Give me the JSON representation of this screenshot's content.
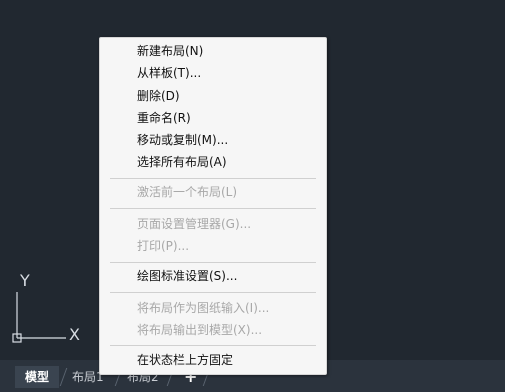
{
  "context_menu": {
    "items": [
      {
        "label": "新建布局(N)",
        "enabled": true
      },
      {
        "label": "从样板(T)...",
        "enabled": true
      },
      {
        "label": "删除(D)",
        "enabled": true
      },
      {
        "label": "重命名(R)",
        "enabled": true
      },
      {
        "label": "移动或复制(M)...",
        "enabled": true
      },
      {
        "label": "选择所有布局(A)",
        "enabled": true
      },
      {
        "label": "激活前一个布局(L)",
        "enabled": false
      },
      {
        "label": "页面设置管理器(G)...",
        "enabled": false
      },
      {
        "label": "打印(P)...",
        "enabled": false
      },
      {
        "label": "绘图标准设置(S)...",
        "enabled": true
      },
      {
        "label": "将布局作为图纸输入(I)...",
        "enabled": false
      },
      {
        "label": "将布局输出到模型(X)...",
        "enabled": false
      },
      {
        "label": "在状态栏上方固定",
        "enabled": true
      }
    ]
  },
  "ucs": {
    "y_label": "Y",
    "x_label": "X"
  },
  "tabs": {
    "model": "模型",
    "layout1": "布局1",
    "layout2": "布局2",
    "add": "+"
  },
  "colors": {
    "background": "#212830",
    "menu_background": "#f6f6f6",
    "disabled_text": "#a8a8a8"
  }
}
